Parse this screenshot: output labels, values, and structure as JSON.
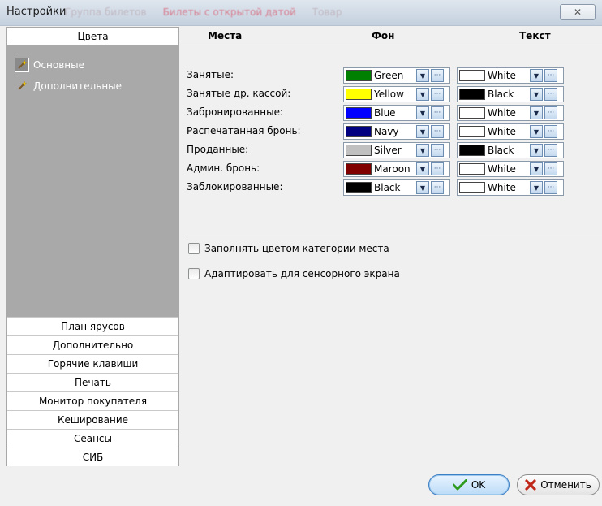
{
  "window": {
    "title": "Настройки",
    "background_tabs": [
      "Группа билетов",
      "Билеты с открытой датой",
      "Товар"
    ],
    "close_glyph": "✕"
  },
  "sidebar": {
    "header": "Цвета",
    "tree": [
      {
        "label": "Основные",
        "icon": "magic-wand-icon",
        "selected": true
      },
      {
        "label": "Дополнительные",
        "icon": "magic-wand-icon",
        "selected": false
      }
    ],
    "sections": [
      "План ярусов",
      "Дополнительно",
      "Горячие клавиши",
      "Печать",
      "Монитор покупателя",
      "Кеширование",
      "Сеансы",
      "СИБ"
    ]
  },
  "table": {
    "col_places": "Места",
    "col_bg": "Фон",
    "col_text": "Текст",
    "rows": [
      {
        "label": "Занятые:",
        "bg": {
          "name": "Green",
          "hex": "#008000"
        },
        "text": {
          "name": "White",
          "hex": "#ffffff"
        }
      },
      {
        "label": "Занятые др. кассой:",
        "bg": {
          "name": "Yellow",
          "hex": "#ffff00"
        },
        "text": {
          "name": "Black",
          "hex": "#000000"
        }
      },
      {
        "label": "Забронированные:",
        "bg": {
          "name": "Blue",
          "hex": "#0000ff"
        },
        "text": {
          "name": "White",
          "hex": "#ffffff"
        }
      },
      {
        "label": "Распечатанная бронь:",
        "bg": {
          "name": "Navy",
          "hex": "#000080"
        },
        "text": {
          "name": "White",
          "hex": "#ffffff"
        }
      },
      {
        "label": "Проданные:",
        "bg": {
          "name": "Silver",
          "hex": "#c0c0c0"
        },
        "text": {
          "name": "Black",
          "hex": "#000000"
        }
      },
      {
        "label": "Админ. бронь:",
        "bg": {
          "name": "Maroon",
          "hex": "#800000"
        },
        "text": {
          "name": "White",
          "hex": "#ffffff"
        }
      },
      {
        "label": "Заблокированные:",
        "bg": {
          "name": "Black",
          "hex": "#000000"
        },
        "text": {
          "name": "White",
          "hex": "#ffffff"
        }
      }
    ]
  },
  "options": {
    "fill_category": {
      "label": "Заполнять цветом категории места",
      "checked": false
    },
    "touch_adapt": {
      "label": "Адаптировать для сенсорного экрана",
      "checked": false
    }
  },
  "buttons": {
    "ok": "OK",
    "cancel": "Отменить"
  }
}
